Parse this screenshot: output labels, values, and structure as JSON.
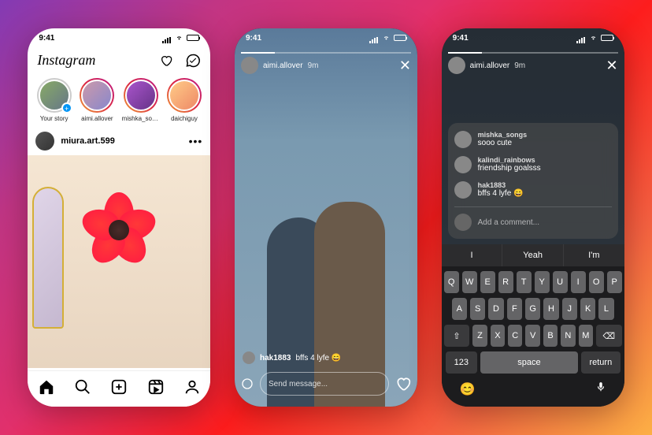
{
  "status_time": "9:41",
  "phone1": {
    "logo": "Instagram",
    "stories": [
      {
        "name": "Your story",
        "own": true
      },
      {
        "name": "aimi.allover"
      },
      {
        "name": "mishka_songs"
      },
      {
        "name": "daichiguy"
      }
    ],
    "post": {
      "username": "miura.art.599",
      "more": "•••"
    }
  },
  "phone2": {
    "header": {
      "username": "aimi.allover",
      "time_ago": "9m"
    },
    "caption": {
      "username": "hak1883",
      "text": "bffs 4 lyfe 😄"
    },
    "reply_placeholder": "Send message..."
  },
  "phone3": {
    "header": {
      "username": "aimi.allover",
      "time_ago": "9m"
    },
    "comments": [
      {
        "user": "mishka_songs",
        "text": "sooo cute"
      },
      {
        "user": "kalindi_rainbows",
        "text": "friendship goalsss"
      },
      {
        "user": "hak1883",
        "text": "bffs 4 lyfe 😄"
      }
    ],
    "comment_placeholder": "Add a comment...",
    "suggestions": [
      "I",
      "Yeah",
      "I'm"
    ],
    "keyboard": {
      "row1": [
        "Q",
        "W",
        "E",
        "R",
        "T",
        "Y",
        "U",
        "I",
        "O",
        "P"
      ],
      "row2": [
        "A",
        "S",
        "D",
        "F",
        "G",
        "H",
        "J",
        "K",
        "L"
      ],
      "row3": [
        "Z",
        "X",
        "C",
        "V",
        "B",
        "N",
        "M"
      ],
      "shift": "⇧",
      "backspace": "⌫",
      "numkey": "123",
      "space": "space",
      "return": "return"
    }
  }
}
